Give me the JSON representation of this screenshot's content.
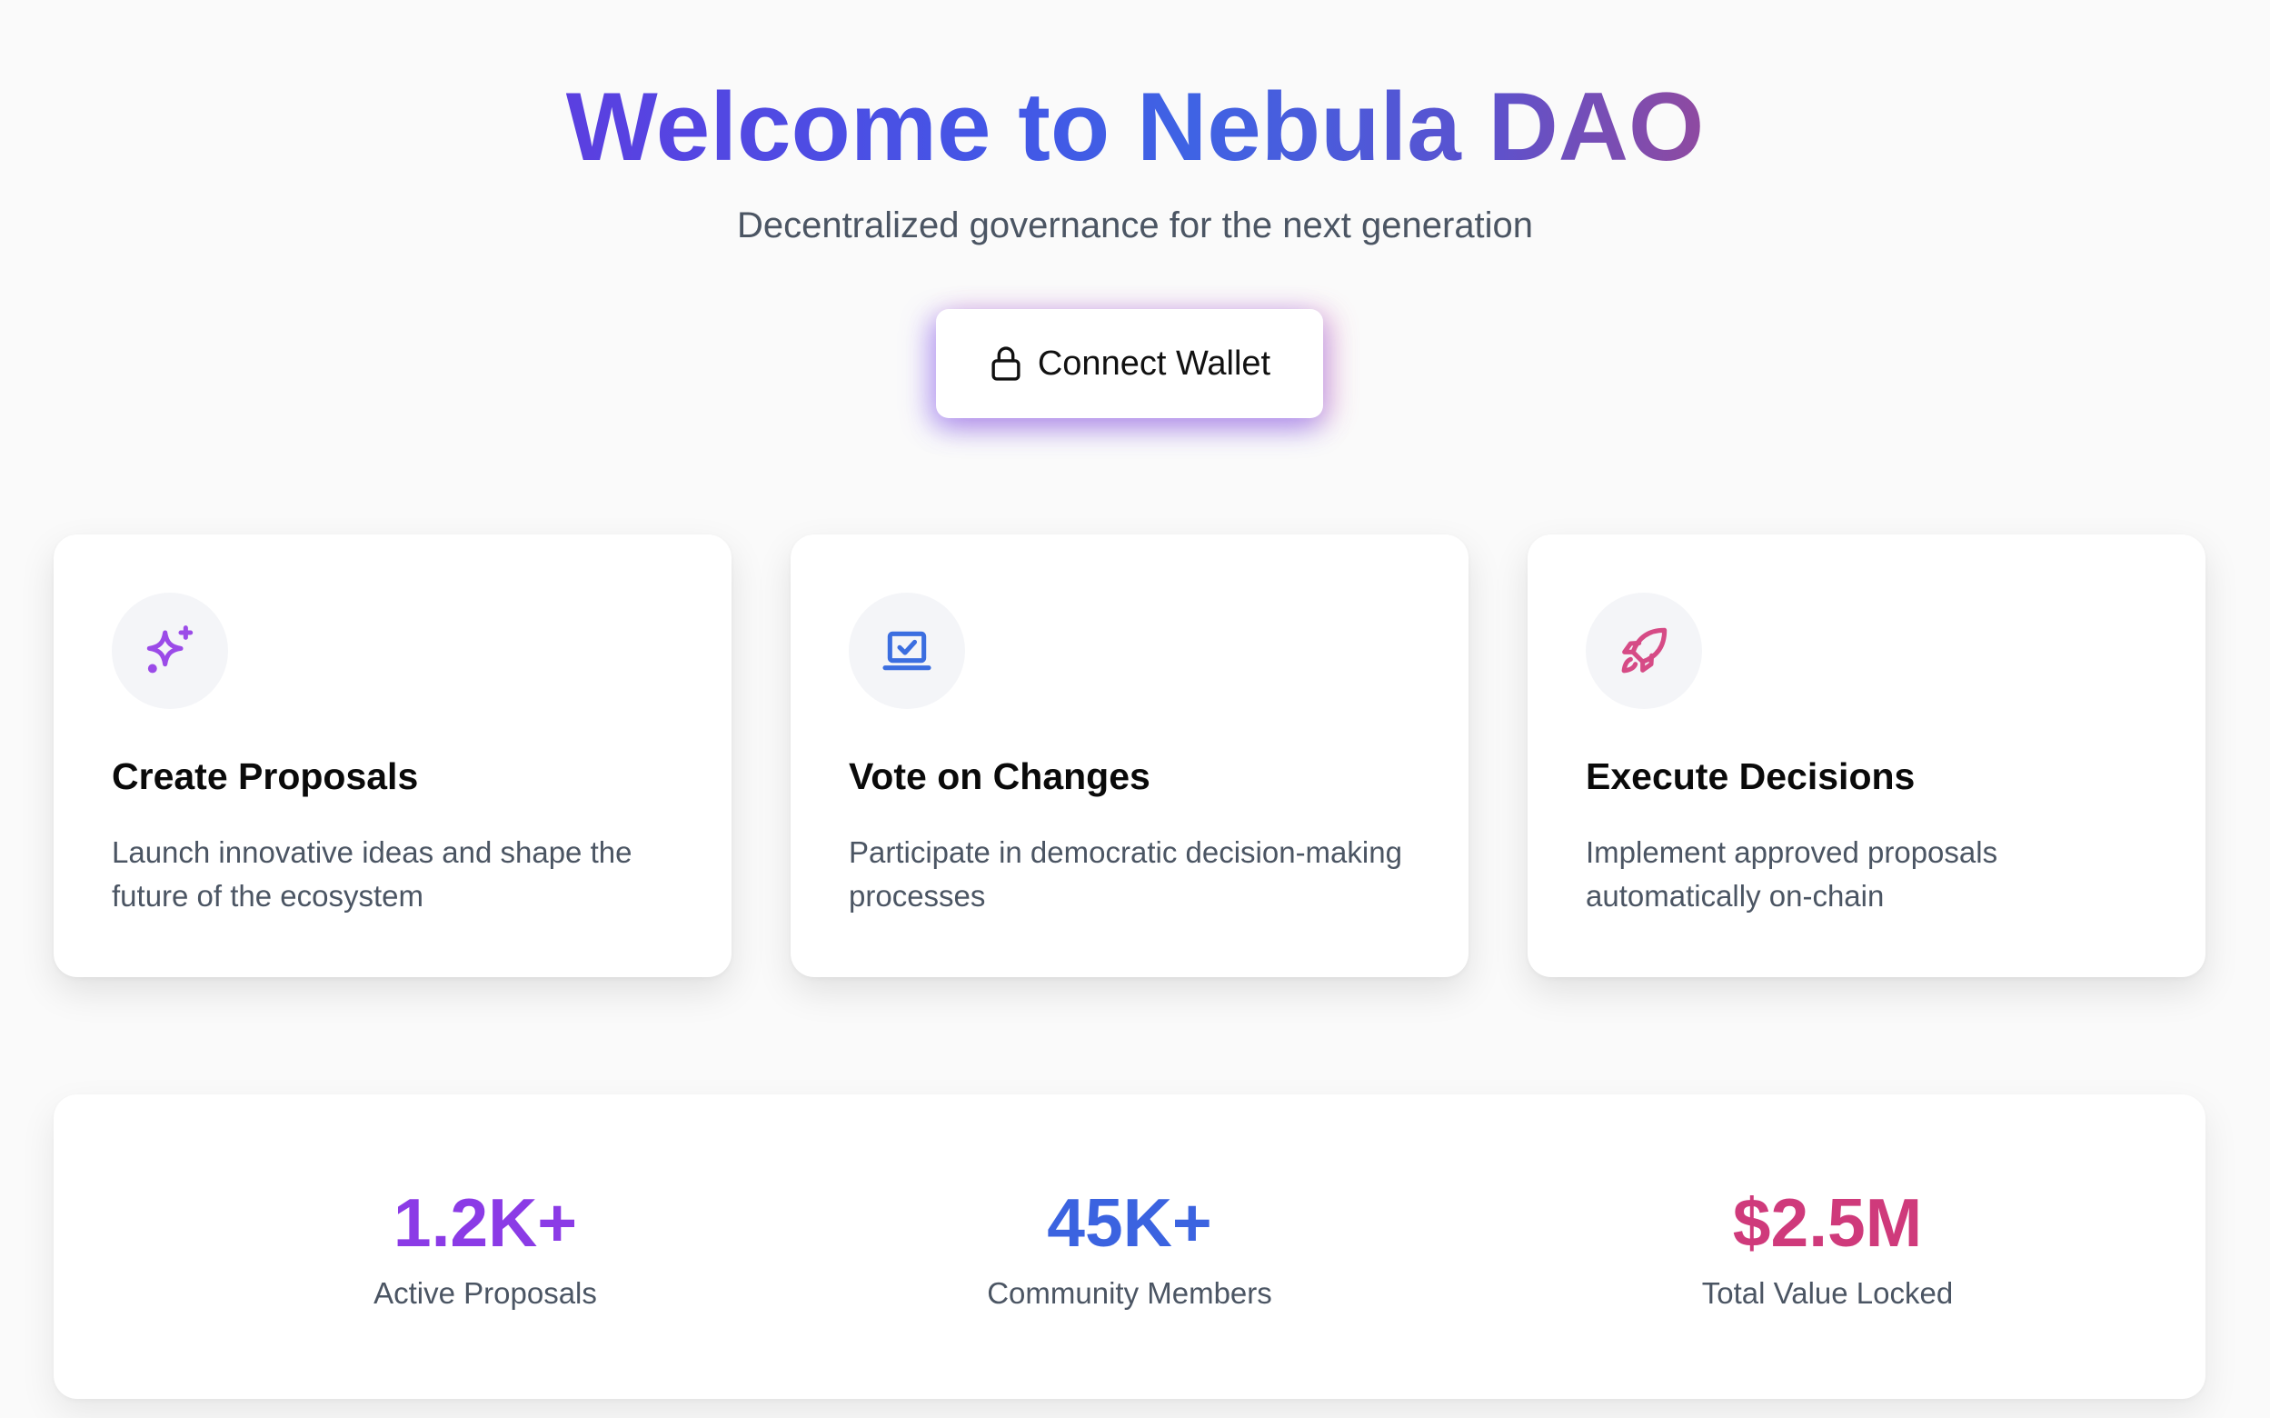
{
  "hero": {
    "title": "Welcome to Nebula DAO",
    "subtitle": "Decentralized governance for the next generation",
    "connect_button_label": "Connect Wallet",
    "connect_button_icon": "lock-icon"
  },
  "features": [
    {
      "icon": "sparkles-icon",
      "icon_color": "#9b4be8",
      "title": "Create Proposals",
      "description": "Launch innovative ideas and shape the future of the ecosystem"
    },
    {
      "icon": "laptop-check-icon",
      "icon_color": "#3b6ee0",
      "title": "Vote on Changes",
      "description": "Participate in democratic decision-making processes"
    },
    {
      "icon": "rocket-icon",
      "icon_color": "#d64b86",
      "title": "Execute Decisions",
      "description": "Implement approved proposals automatically on-chain"
    }
  ],
  "stats": [
    {
      "value": "1.2K+",
      "label": "Active Proposals",
      "color": "#8b3be6"
    },
    {
      "value": "45K+",
      "label": "Community Members",
      "color": "#3b63e0"
    },
    {
      "value": "$2.5M",
      "label": "Total Value Locked",
      "color": "#cf3a7b"
    }
  ],
  "colors": {
    "background": "#fafafa",
    "title_gradient_start": "#5b3fe0",
    "title_gradient_mid": "#3f63e4",
    "title_gradient_end": "#8f4aa0",
    "body_text": "#4b5563"
  }
}
